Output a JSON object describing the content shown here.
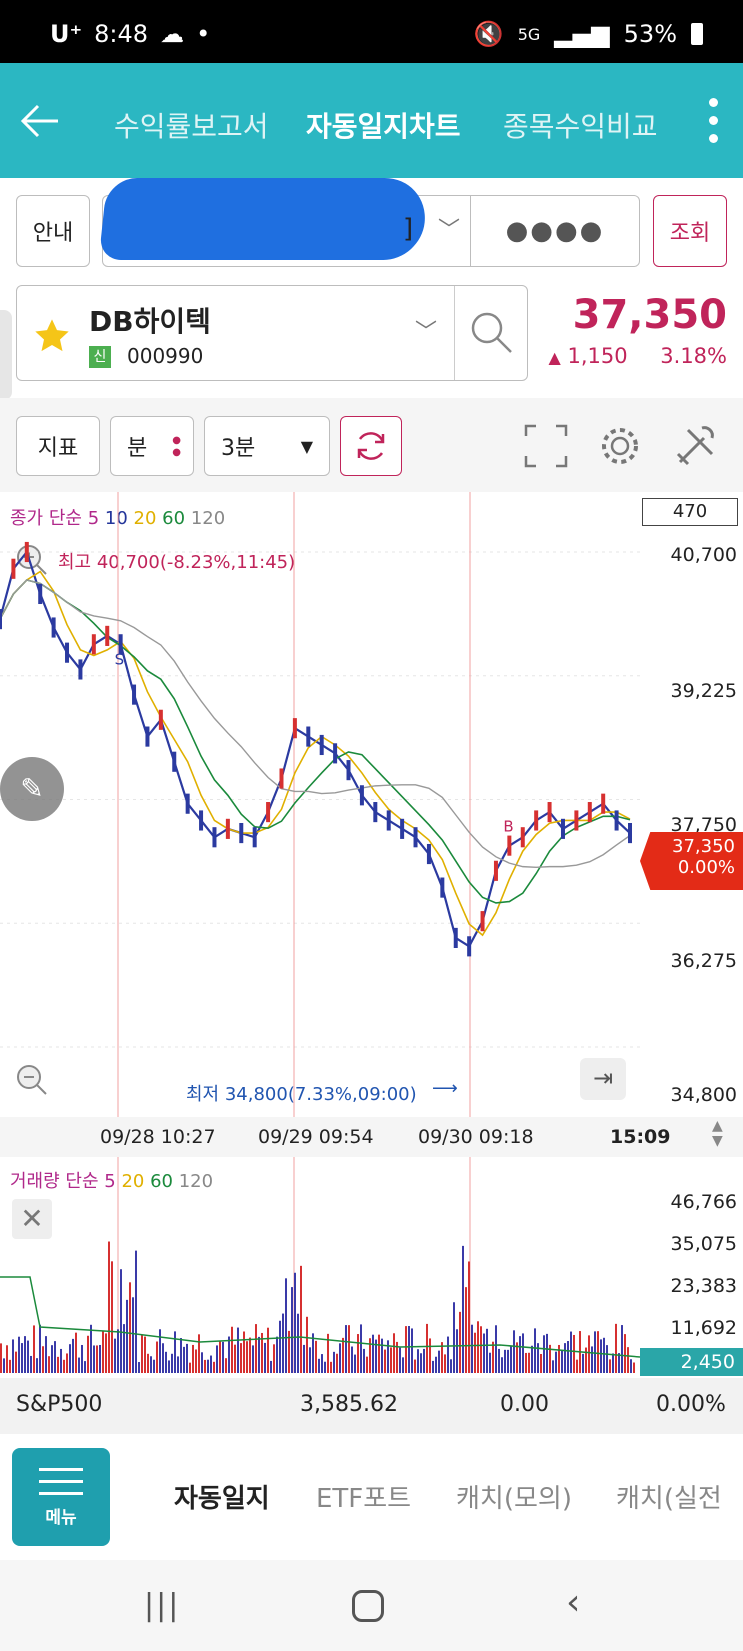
{
  "status_bar": {
    "time": "8:48",
    "carrier": "U⁺",
    "network": "5G",
    "battery": "53%"
  },
  "app_bar": {
    "tabs": [
      "수익률보고서",
      "자동일지차트",
      "종목수익비교"
    ],
    "active_tab": 1
  },
  "account": {
    "guide_label": "안내",
    "account_bracket": "]",
    "password_mask": "●●●●",
    "query_label": "조회"
  },
  "stock": {
    "name": "DB하이텍",
    "code": "000990",
    "market_badge": "신",
    "price": "37,350",
    "change": "1,150",
    "change_pct": "3.18%",
    "change_arrow": "▲"
  },
  "toolbar": {
    "indicator_label": "지표",
    "period_label": "분",
    "interval": "3분"
  },
  "price_chart": {
    "legend": {
      "prefix": "종가 단순",
      "ma": [
        "5",
        "10",
        "20",
        "60",
        "120"
      ]
    },
    "count_box": "470",
    "high_label": "최고 40,700(-8.23%,11:45)",
    "low_label": "최저 34,800(7.33%,09:00)",
    "y_ticks": [
      "40,700",
      "39,225",
      "37,750",
      "36,275",
      "34,800"
    ],
    "current_price": "37,350",
    "current_pct": "0.00%",
    "x_ticks": [
      "09/28 10:27",
      "09/29 09:54",
      "09/30 09:18"
    ],
    "x_last": "15:09",
    "markers": [
      "S",
      "B"
    ]
  },
  "volume_chart": {
    "legend": {
      "prefix": "거래량 단순",
      "ma": [
        "5",
        "20",
        "60",
        "120"
      ]
    },
    "y_ticks": [
      "46,766",
      "35,075",
      "23,383",
      "11,692"
    ],
    "current": "2,450"
  },
  "index_row": {
    "name": "S&P500",
    "value": "3,585.62",
    "change": "0.00",
    "pct": "0.00%"
  },
  "bottom_menu": {
    "menu_label": "메뉴",
    "tabs": [
      "자동일지",
      "ETF포트",
      "캐치(모의)",
      "캐치(실전"
    ]
  },
  "chart_data": {
    "type": "line",
    "series": [
      {
        "values": [
          39900,
          40500,
          40700,
          40200,
          39800,
          39500,
          39300,
          39600,
          39700,
          39600,
          39000,
          38500,
          38700,
          38200,
          37700,
          37500,
          37300,
          37400,
          37350,
          37300,
          37600,
          38000,
          38600,
          38500,
          38400,
          38300,
          38100,
          37800,
          37600,
          37500,
          37400,
          37300,
          37100,
          36700,
          36100,
          36000,
          36300,
          36900,
          37200,
          37300,
          37500,
          37600,
          37400,
          37500,
          37600,
          37700,
          37500,
          37350
        ]
      }
    ],
    "ylim": [
      34800,
      40700
    ]
  },
  "colors": {
    "teal": "#2bb7c2",
    "price_red": "#c0245a",
    "current_red": "#e32b17"
  }
}
